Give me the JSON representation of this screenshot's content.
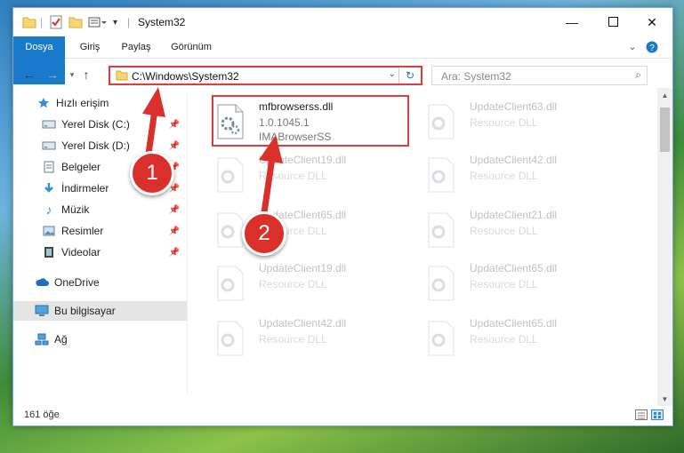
{
  "window": {
    "title": "System32"
  },
  "ribbon": {
    "tabs": [
      "Dosya",
      "Giriş",
      "Paylaş",
      "Görünüm"
    ]
  },
  "address": {
    "path": "C:\\Windows\\System32"
  },
  "search": {
    "placeholder": "Ara: System32"
  },
  "sidebar": {
    "items": [
      {
        "label": "Hızlı erişim",
        "icon": "star-icon",
        "pinned": false
      },
      {
        "label": "Yerel Disk (C:)",
        "icon": "drive-icon",
        "pinned": true
      },
      {
        "label": "Yerel Disk (D:)",
        "icon": "drive-icon",
        "pinned": true
      },
      {
        "label": "Belgeler",
        "icon": "documents-icon",
        "pinned": true
      },
      {
        "label": "İndirmeler",
        "icon": "download-icon",
        "pinned": true
      },
      {
        "label": "Müzik",
        "icon": "music-icon",
        "pinned": true
      },
      {
        "label": "Resimler",
        "icon": "pictures-icon",
        "pinned": true
      },
      {
        "label": "Videolar",
        "icon": "videos-icon",
        "pinned": true
      },
      {
        "label": "OneDrive",
        "icon": "cloud-icon",
        "pinned": false
      },
      {
        "label": "Bu bilgisayar",
        "icon": "computer-icon",
        "pinned": false
      },
      {
        "label": "Ağ",
        "icon": "network-icon",
        "pinned": false
      }
    ]
  },
  "files": [
    {
      "name": "mfbrowserss.dll",
      "line2": "1.0.1045.1",
      "line3": "IMABrowserSS"
    },
    {
      "name": "UpdateClient63.dll",
      "line2": "Resource DLL"
    },
    {
      "name": "UpdateClient19.dll",
      "line2": "Resource DLL"
    },
    {
      "name": "UpdateClient42.dll",
      "line2": "Resource DLL"
    },
    {
      "name": "UpdateClient65.dll",
      "line2": "Resource DLL"
    },
    {
      "name": "UpdateClient21.dll",
      "line2": "Resource DLL"
    },
    {
      "name": "UpdateClient19.dll",
      "line2": "Resource DLL"
    },
    {
      "name": "UpdateClient65.dll",
      "line2": "Resource DLL"
    },
    {
      "name": "UpdateClient42.dll",
      "line2": "Resource DLL"
    },
    {
      "name": "UpdateClient65.dll",
      "line2": "Resource DLL"
    }
  ],
  "status": {
    "count": "161 öğe"
  },
  "annotations": {
    "step1": "1",
    "step2": "2"
  },
  "colors": {
    "accent": "#1979ca",
    "highlight": "#e03c3c"
  }
}
